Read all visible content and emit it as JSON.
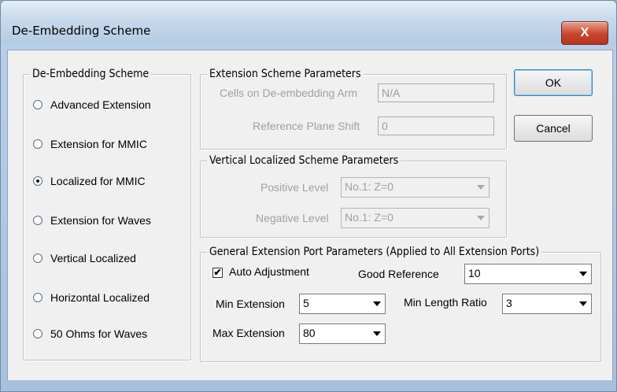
{
  "window": {
    "title": "De-Embedding Scheme",
    "close_label": "X"
  },
  "scheme_group": {
    "legend": "De-Embedding Scheme",
    "options": [
      {
        "label": "Advanced Extension",
        "checked": false
      },
      {
        "label": "Extension for MMIC",
        "checked": false
      },
      {
        "label": "Localized for MMIC",
        "checked": true
      },
      {
        "label": "Extension for Waves",
        "checked": false
      },
      {
        "label": "Vertical Localized",
        "checked": false
      },
      {
        "label": "Horizontal Localized",
        "checked": false
      },
      {
        "label": "50 Ohms for Waves",
        "checked": false
      }
    ]
  },
  "extension_params": {
    "legend": "Extension Scheme Parameters",
    "cells_label": "Cells on De-embedding Arm",
    "cells_value": "N/A",
    "shift_label": "Reference Plane Shift",
    "shift_value": "0"
  },
  "vertical_params": {
    "legend": "Vertical Localized Scheme Parameters",
    "positive_label": "Positive Level",
    "positive_value": "No.1: Z=0",
    "negative_label": "Negative Level",
    "negative_value": "No.1: Z=0"
  },
  "general_params": {
    "legend": "General Extension Port Parameters (Applied to All Extension Ports)",
    "auto_adjust_label": "Auto Adjustment",
    "auto_adjust_checked": true,
    "good_reference_label": "Good Reference",
    "good_reference_value": "10",
    "min_extension_label": "Min Extension",
    "min_extension_value": "5",
    "min_length_ratio_label": "Min Length Ratio",
    "min_length_ratio_value": "3",
    "max_extension_label": "Max Extension",
    "max_extension_value": "80"
  },
  "buttons": {
    "ok": "OK",
    "cancel": "Cancel"
  }
}
